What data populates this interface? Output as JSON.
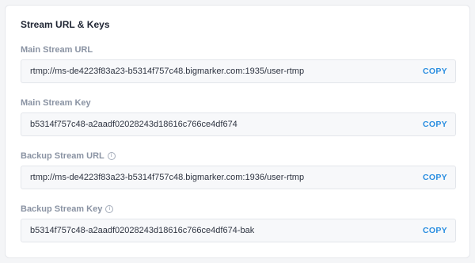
{
  "card": {
    "title": "Stream URL & Keys"
  },
  "fields": [
    {
      "label": "Main Stream URL",
      "value": "rtmp://ms-de4223f83a23-b5314f757c48.bigmarker.com:1935/user-rtmp",
      "copy_label": "COPY",
      "info": false
    },
    {
      "label": "Main Stream Key",
      "value": "b5314f757c48-a2aadf02028243d18616c766ce4df674",
      "copy_label": "COPY",
      "info": false
    },
    {
      "label": "Backup Stream URL",
      "value": "rtmp://ms-de4223f83a23-b5314f757c48.bigmarker.com:1936/user-rtmp",
      "copy_label": "COPY",
      "info": true,
      "info_icon": "info-circle-icon"
    },
    {
      "label": "Backup Stream Key",
      "value": "b5314f757c48-a2aadf02028243d18616c766ce4df674-bak",
      "copy_label": "COPY",
      "info": true,
      "info_icon": "info-circle-icon"
    }
  ],
  "colors": {
    "accent": "#2a8ee0",
    "label": "#8a93a3",
    "title": "#1f2533"
  }
}
